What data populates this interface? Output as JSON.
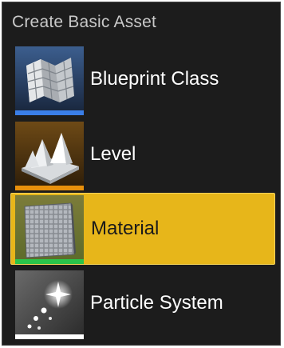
{
  "menu": {
    "header": "Create Basic Asset",
    "items": [
      {
        "label": "Blueprint Class",
        "icon": "blueprint-icon",
        "stripe_color": "#3a7ee8",
        "selected": false
      },
      {
        "label": "Level",
        "icon": "level-icon",
        "stripe_color": "#e8900c",
        "selected": false
      },
      {
        "label": "Material",
        "icon": "material-icon",
        "stripe_color": "#2bc44a",
        "selected": true
      },
      {
        "label": "Particle System",
        "icon": "particle-system-icon",
        "stripe_color": "#ffffff",
        "selected": false
      }
    ]
  },
  "colors": {
    "background": "#1c1c1c",
    "selected_background": "#e7b61a"
  }
}
